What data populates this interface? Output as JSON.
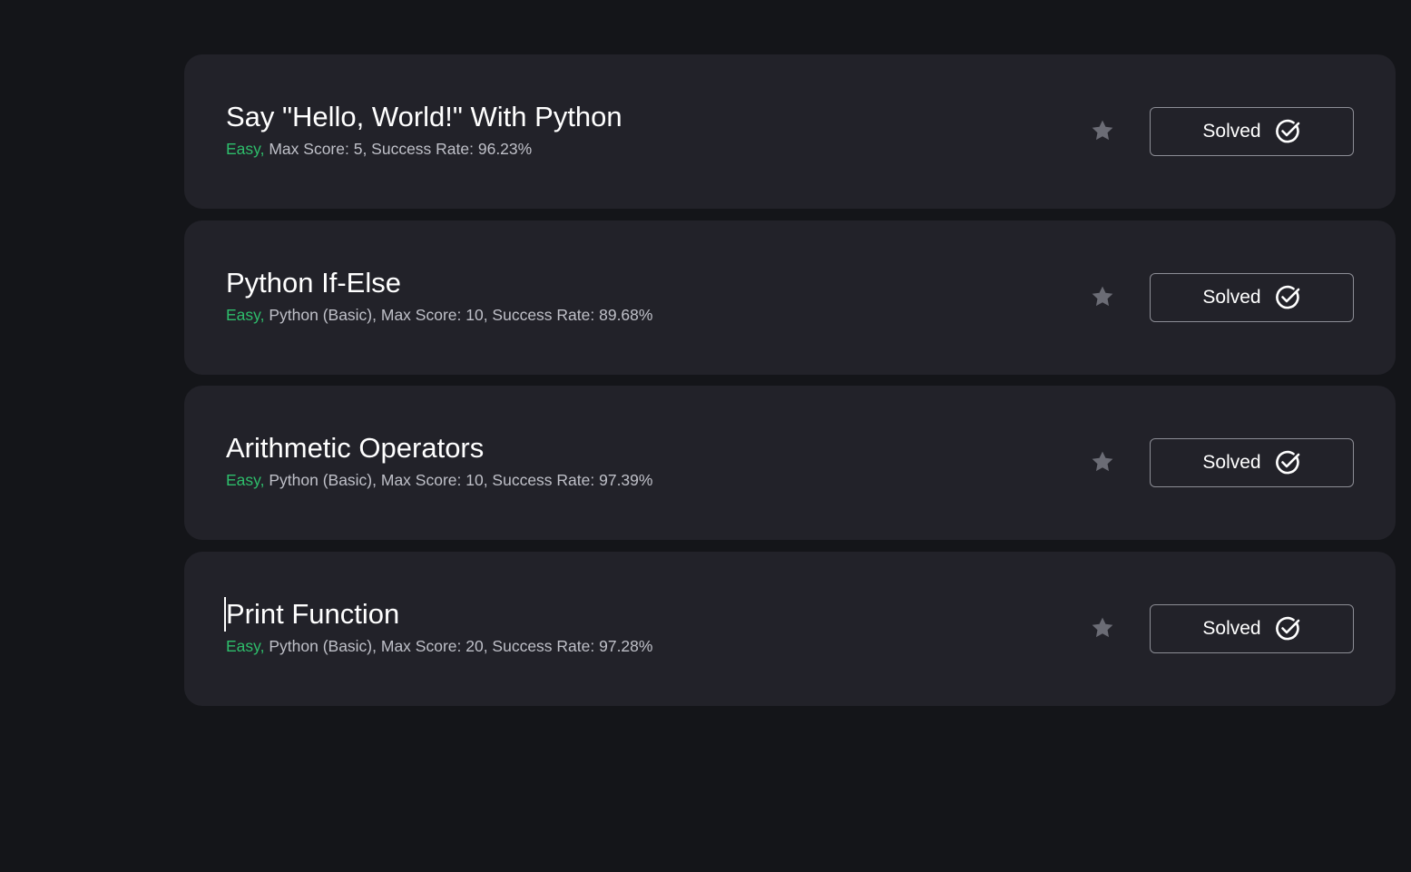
{
  "challenges": [
    {
      "title": "Say \"Hello, World!\" With Python",
      "difficulty": "Easy,",
      "details": "Max Score: 5, Success Rate: 96.23%",
      "status": "Solved"
    },
    {
      "title": "Python If-Else",
      "difficulty": "Easy,",
      "details": "Python (Basic), Max Score: 10, Success Rate: 89.68%",
      "status": "Solved"
    },
    {
      "title": "Arithmetic Operators",
      "difficulty": "Easy,",
      "details": "Python (Basic), Max Score: 10, Success Rate: 97.39%",
      "status": "Solved"
    },
    {
      "title": "Print Function",
      "difficulty": "Easy,",
      "details": "Python (Basic), Max Score: 20, Success Rate: 97.28%",
      "status": "Solved"
    }
  ],
  "icons": {
    "bookmark": "star-icon",
    "status": "check-circle-icon"
  },
  "colors": {
    "background": "#141519",
    "card": "#222229",
    "difficulty_easy": "#2ebd6b",
    "meta_text": "#bfc0c8",
    "star": "#6b6c75",
    "button_border": "#8d8e96"
  }
}
